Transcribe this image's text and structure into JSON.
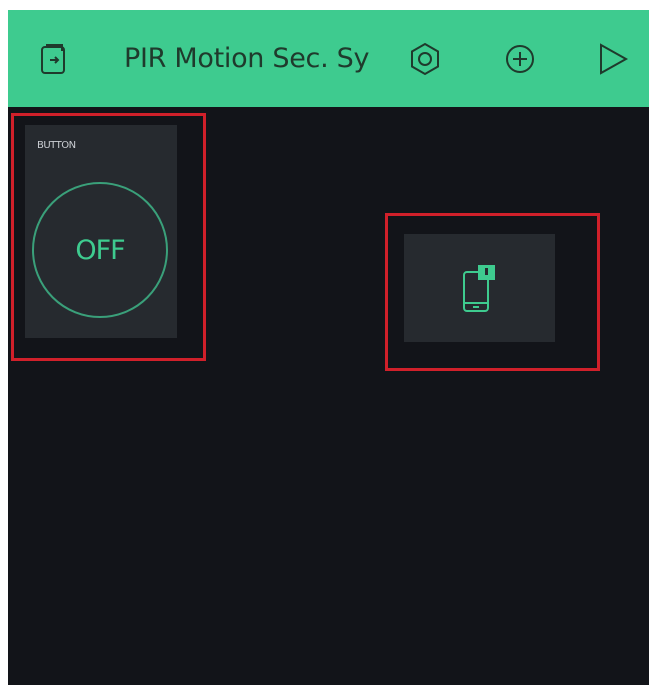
{
  "app": {
    "title": "PIR Motion Sec. Sy"
  },
  "toolbar": {
    "back_icon": "exit-door-icon",
    "settings_icon": "hexagon-nut-icon",
    "add_icon": "plus-circle-icon",
    "play_icon": "play-triangle-icon"
  },
  "widgets": {
    "button": {
      "label": "BUTTON",
      "state": "OFF"
    },
    "notification": {
      "icon": "phone-notification-icon"
    }
  },
  "colors": {
    "accent": "#3ecb8f",
    "background": "#121419",
    "widget_bg": "#262a2f",
    "highlight": "#d0202a"
  }
}
